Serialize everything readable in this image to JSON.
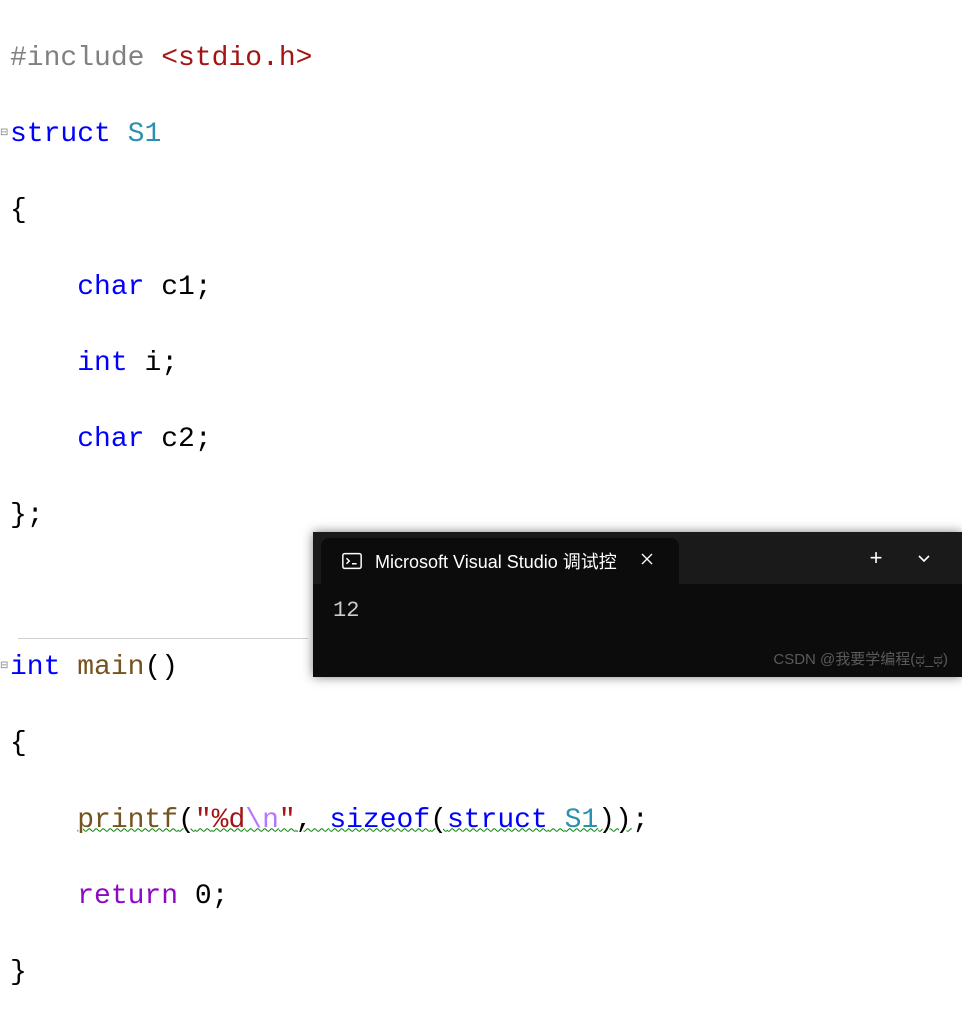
{
  "code": {
    "line1": {
      "pre": "#include",
      "space": " ",
      "path": "<stdio.h>"
    },
    "line2": {
      "kw": "struct",
      "name": "S1"
    },
    "line3": "{",
    "line4": {
      "type": "char",
      "id": "c1",
      "punct": ";"
    },
    "line5": {
      "type": "int",
      "id": "i",
      "punct": ";"
    },
    "line6": {
      "type": "char",
      "id": "c2",
      "punct": ";"
    },
    "line7": "};",
    "line9": {
      "type": "int",
      "name": "main",
      "paren": "()"
    },
    "line10": "{",
    "line11": {
      "func": "printf",
      "open": "(",
      "q1": "\"",
      "fmt": "%d",
      "esc": "\\n",
      "q2": "\"",
      "comma": ", ",
      "sz": "sizeof",
      "open2": "(",
      "st": "struct",
      "tn": "S1",
      "close": "))",
      "punct": ";"
    },
    "line12": {
      "ret": "return",
      "val": "0",
      "punct": ";"
    },
    "line13": "}"
  },
  "console": {
    "title": "Microsoft Visual Studio 调试控",
    "plus": "+",
    "output": "12",
    "watermark": "CSDN @我要学编程(ಥ_ಥ)"
  }
}
